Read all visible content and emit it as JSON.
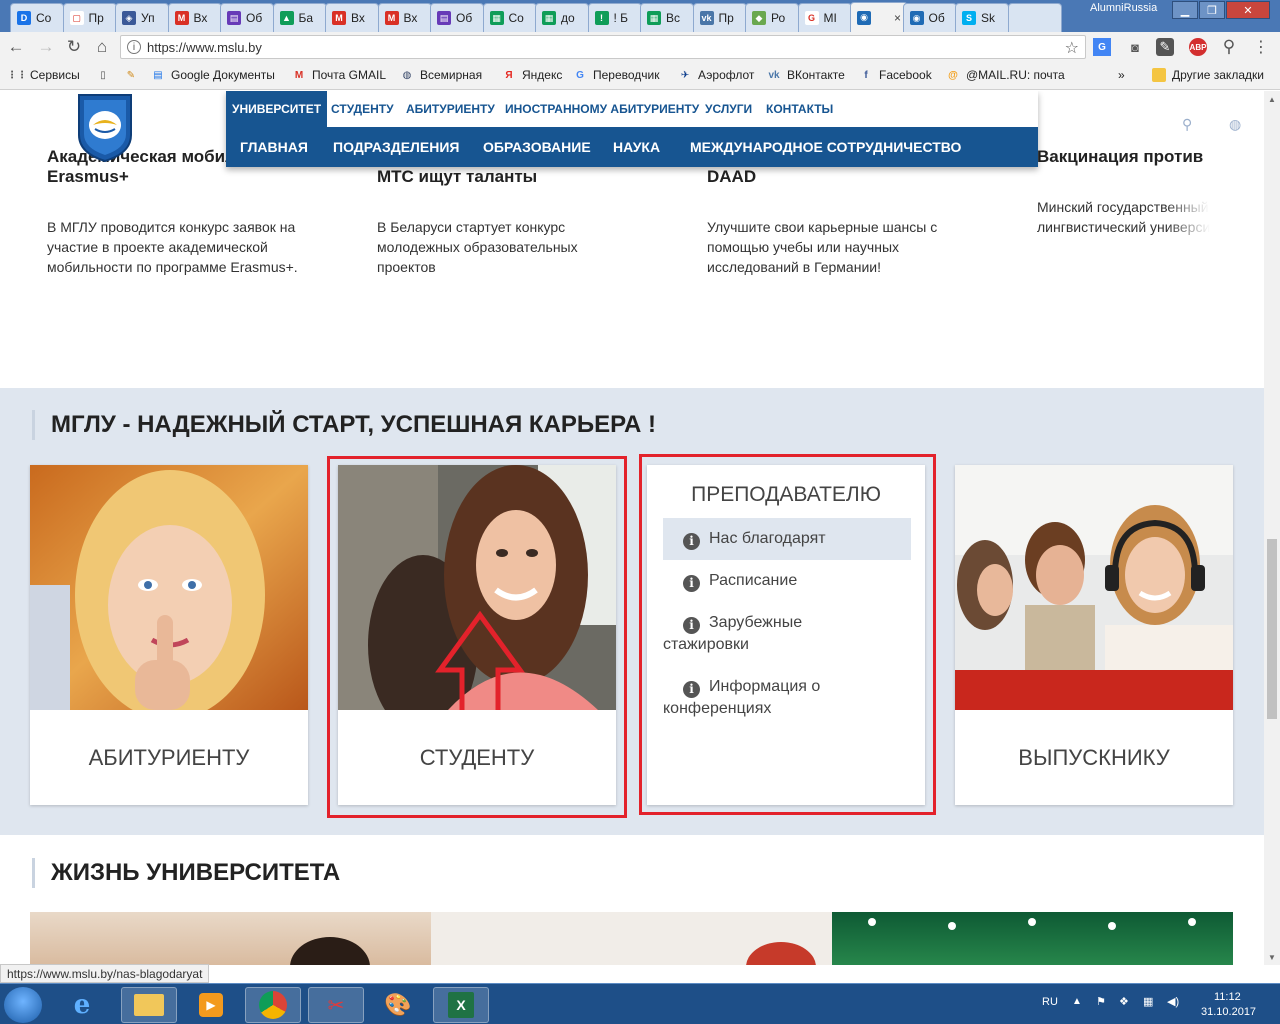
{
  "browser": {
    "tabs": [
      {
        "label": "Co",
        "color": "#1a73e8",
        "glyph": "D"
      },
      {
        "label": "Пр",
        "color": "#ffffff",
        "glyph": "▢"
      },
      {
        "label": "Уп",
        "color": "#3b5998",
        "glyph": "◈"
      },
      {
        "label": "Вх",
        "color": "#d93025",
        "glyph": "M"
      },
      {
        "label": "Об",
        "color": "#673ab7",
        "glyph": "▤"
      },
      {
        "label": "Ба",
        "color": "#0f9d58",
        "glyph": "▲"
      },
      {
        "label": "Вх",
        "color": "#d93025",
        "glyph": "M"
      },
      {
        "label": "Вх",
        "color": "#d93025",
        "glyph": "M"
      },
      {
        "label": "Об",
        "color": "#673ab7",
        "glyph": "▤"
      },
      {
        "label": "Co",
        "color": "#0f9d58",
        "glyph": "▦"
      },
      {
        "label": "до",
        "color": "#0f9d58",
        "glyph": "▦"
      },
      {
        "label": "! Б",
        "color": "#0f9d58",
        "glyph": "!"
      },
      {
        "label": "Вс",
        "color": "#0f9d58",
        "glyph": "▦"
      },
      {
        "label": "Пр",
        "color": "#4a76a8",
        "glyph": "vk"
      },
      {
        "label": "Ро",
        "color": "#6aa84f",
        "glyph": "◆"
      },
      {
        "label": "МІ",
        "color": "#ffffff",
        "glyph": "G"
      },
      {
        "label": "",
        "color": "#1f6bb5",
        "glyph": "◉",
        "active": true
      },
      {
        "label": "Об",
        "color": "#1f6bb5",
        "glyph": "◉"
      },
      {
        "label": "Sk",
        "color": "#00aff0",
        "glyph": "S"
      },
      {
        "label": "",
        "color": "#d9e4f2",
        "glyph": ""
      }
    ],
    "user": "AlumniRussia",
    "url": "https://www.mslu.by",
    "bookmarks": [
      {
        "label": "Сервисы",
        "icon": "apps-icon",
        "color": "#555555",
        "glyph": "⋮⋮"
      },
      {
        "label": "",
        "icon": "page-icon",
        "color": "#555555",
        "glyph": "▯"
      },
      {
        "label": "",
        "icon": "brush-icon",
        "color": "#d08a1a",
        "glyph": "✎"
      },
      {
        "label": "Google Документы",
        "icon": "docs-icon",
        "color": "#1a73e8",
        "glyph": "▤"
      },
      {
        "label": "Почта GMAIL",
        "icon": "gmail-icon",
        "color": "#d93025",
        "glyph": "M"
      },
      {
        "label": "Всемирная",
        "icon": "globe-icon",
        "color": "#334466",
        "glyph": "◍"
      },
      {
        "label": "Яндекс",
        "icon": "yandex-icon",
        "color": "#e52620",
        "glyph": "Я"
      },
      {
        "label": "Переводчик",
        "icon": "translate-icon",
        "color": "#4285f4",
        "glyph": "G"
      },
      {
        "label": "Аэрофлот",
        "icon": "aeroflot-icon",
        "color": "#0b3c8c",
        "glyph": "✈"
      },
      {
        "label": "ВКонтакте",
        "icon": "vk-icon",
        "color": "#4a76a8",
        "glyph": "vk"
      },
      {
        "label": "Facebook",
        "icon": "facebook-icon",
        "color": "#3b5998",
        "glyph": "f"
      },
      {
        "label": "@MAIL.RU: почта",
        "icon": "mailru-icon",
        "color": "#f39c12",
        "glyph": "@"
      }
    ],
    "more_bookmarks": "»",
    "other_bookmarks": "Другие закладки",
    "status_url": "https://www.mslu.by/nas-blagodaryat"
  },
  "site": {
    "top_menu": [
      "УНИВЕРСИТЕТ",
      "СТУДЕНТУ",
      "АБИТУРИЕНТУ",
      "ИНОСТРАННОМУ АБИТУРИЕНТУ",
      "УСЛУГИ",
      "КОНТАКТЫ"
    ],
    "sub_menu": [
      "ГЛАВНАЯ",
      "ПОДРАЗДЕЛЕНИЯ",
      "ОБРАЗОВАНИЕ",
      "НАУКА",
      "МЕЖДУНАРОДНОЕ СОТРУДНИЧЕСТВО"
    ],
    "news": [
      {
        "title_partial": "Академическая мобил…",
        "title2": "Erasmus+",
        "text": [
          "В МГЛУ проводится конкурс заявок на",
          "участие в проекте академической",
          "мобильности по программе Erasmus+."
        ]
      },
      {
        "title_partial": "",
        "title2": "МТС ищут таланты",
        "text": [
          "В Беларуси стартует конкурс",
          "молодежных образовательных",
          "проектов"
        ]
      },
      {
        "title_partial": "",
        "title2": "DAAD",
        "text": [
          "Улучшите свои карьерные шансы с",
          "помощью учебы или научных",
          "исследований в Германии!"
        ]
      },
      {
        "title_partial": "Вакцинация против",
        "title2": "",
        "text": [
          "Минский государственный",
          "лингвистический универси"
        ]
      }
    ],
    "career_title": "МГЛУ - НАДЕЖНЫЙ СТАРТ, УСПЕШНАЯ КАРЬЕРА !",
    "cards": [
      "АБИТУРИЕНТУ",
      "СТУДЕНТУ",
      "ВЫПУСКНИКУ"
    ],
    "teacher": {
      "title": "ПРЕПОДАВАТЕЛЮ",
      "items": [
        {
          "line1": "Нас благодарят",
          "line2": ""
        },
        {
          "line1": "Расписание",
          "line2": ""
        },
        {
          "line1": "Зарубежные",
          "line2": "стажировки"
        },
        {
          "line1": "Информация о",
          "line2": "конференциях"
        }
      ]
    },
    "life_title": "ЖИЗНЬ УНИВЕРСИТЕТА"
  },
  "taskbar": {
    "lang": "RU",
    "time": "11:12",
    "date": "31.10.2017"
  }
}
